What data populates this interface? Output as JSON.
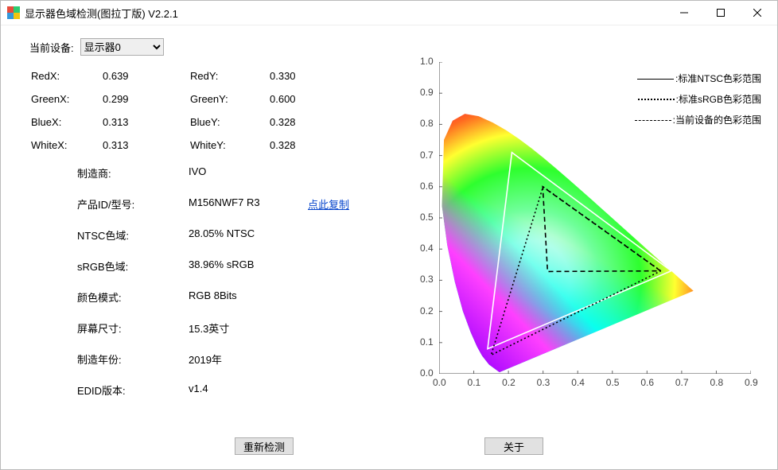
{
  "window": {
    "title": "显示器色域检测(图拉丁版) V2.2.1"
  },
  "device": {
    "label": "当前设备:",
    "selected": "显示器0"
  },
  "coords": {
    "RedX": {
      "label": "RedX:",
      "value": "0.639"
    },
    "RedY": {
      "label": "RedY:",
      "value": "0.330"
    },
    "GreenX": {
      "label": "GreenX:",
      "value": "0.299"
    },
    "GreenY": {
      "label": "GreenY:",
      "value": "0.600"
    },
    "BlueX": {
      "label": "BlueX:",
      "value": "0.313"
    },
    "BlueY": {
      "label": "BlueY:",
      "value": "0.328"
    },
    "WhiteX": {
      "label": "WhiteX:",
      "value": "0.313"
    },
    "WhiteY": {
      "label": "WhiteY:",
      "value": "0.328"
    }
  },
  "info": {
    "manufacturer": {
      "label": "制造商:",
      "value": "IVO"
    },
    "product": {
      "label": "产品ID/型号:",
      "value": "M156NWF7 R3",
      "copy": "点此复制"
    },
    "ntsc": {
      "label": "NTSC色域:",
      "value": "28.05% NTSC"
    },
    "srgb": {
      "label": "sRGB色域:",
      "value": "38.96% sRGB"
    },
    "color_mode": {
      "label": "颜色模式:",
      "value": "RGB 8Bits"
    },
    "screen_size": {
      "label": "屏幕尺寸:",
      "value": "15.3英寸"
    },
    "mfg_year": {
      "label": "制造年份:",
      "value": "2019年"
    },
    "edid": {
      "label": "EDID版本:",
      "value": "v1.4"
    }
  },
  "buttons": {
    "redetect": "重新检测",
    "about": "关于"
  },
  "legend": {
    "ntsc": ":标准NTSC色彩范围",
    "srgb": ":标准sRGB色彩范围",
    "device": ":当前设备的色彩范围"
  },
  "chart_data": {
    "type": "scatter",
    "title": "",
    "xlabel": "",
    "ylabel": "",
    "xlim": [
      0.0,
      0.9
    ],
    "ylim": [
      0.0,
      1.0
    ],
    "xticks": [
      0.0,
      0.1,
      0.2,
      0.3,
      0.4,
      0.5,
      0.6,
      0.7,
      0.8,
      0.9
    ],
    "yticks": [
      0.0,
      0.1,
      0.2,
      0.3,
      0.4,
      0.5,
      0.6,
      0.7,
      0.8,
      0.9,
      1.0
    ],
    "series": [
      {
        "name": "标准NTSC色彩范围",
        "style": "solid",
        "color": "#ffffff",
        "points": [
          [
            0.67,
            0.33
          ],
          [
            0.21,
            0.71
          ],
          [
            0.14,
            0.08
          ],
          [
            0.67,
            0.33
          ]
        ]
      },
      {
        "name": "标准sRGB色彩范围",
        "style": "dotted",
        "color": "#000000",
        "points": [
          [
            0.64,
            0.33
          ],
          [
            0.3,
            0.6
          ],
          [
            0.15,
            0.06
          ],
          [
            0.64,
            0.33
          ]
        ]
      },
      {
        "name": "当前设备的色彩范围",
        "style": "dashed",
        "color": "#000000",
        "points": [
          [
            0.639,
            0.33
          ],
          [
            0.299,
            0.6
          ],
          [
            0.313,
            0.328
          ],
          [
            0.639,
            0.33
          ]
        ]
      }
    ],
    "spectral_locus": [
      [
        0.1741,
        0.005
      ],
      [
        0.144,
        0.0297
      ],
      [
        0.1241,
        0.0578
      ],
      [
        0.1096,
        0.0868
      ],
      [
        0.0913,
        0.1327
      ],
      [
        0.0687,
        0.2007
      ],
      [
        0.0454,
        0.295
      ],
      [
        0.0235,
        0.4127
      ],
      [
        0.0082,
        0.5384
      ],
      [
        0.0139,
        0.7502
      ],
      [
        0.0389,
        0.812
      ],
      [
        0.0743,
        0.8338
      ],
      [
        0.1142,
        0.8262
      ],
      [
        0.1547,
        0.8059
      ],
      [
        0.1929,
        0.7816
      ],
      [
        0.2296,
        0.7543
      ],
      [
        0.2658,
        0.7243
      ],
      [
        0.3016,
        0.6923
      ],
      [
        0.3373,
        0.6589
      ],
      [
        0.3731,
        0.6245
      ],
      [
        0.4087,
        0.5896
      ],
      [
        0.4441,
        0.5547
      ],
      [
        0.4788,
        0.5202
      ],
      [
        0.5125,
        0.4866
      ],
      [
        0.5448,
        0.4544
      ],
      [
        0.5752,
        0.4242
      ],
      [
        0.6029,
        0.3965
      ],
      [
        0.627,
        0.3725
      ],
      [
        0.6482,
        0.3514
      ],
      [
        0.6658,
        0.334
      ],
      [
        0.6801,
        0.3197
      ],
      [
        0.6915,
        0.3083
      ],
      [
        0.7006,
        0.2993
      ],
      [
        0.714,
        0.2859
      ],
      [
        0.726,
        0.274
      ],
      [
        0.734,
        0.266
      ]
    ]
  }
}
